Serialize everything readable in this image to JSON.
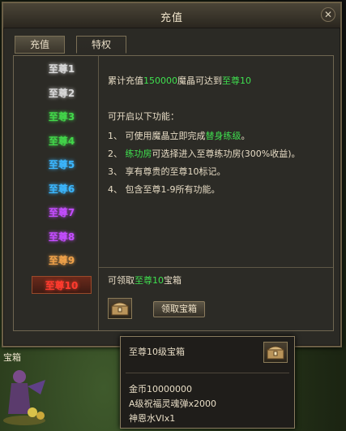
{
  "window": {
    "title": "充值",
    "close_glyph": "✕"
  },
  "tabs": [
    {
      "label": "充值",
      "active": false
    },
    {
      "label": "特权",
      "active": true
    }
  ],
  "vip_levels": [
    {
      "label": "至尊1",
      "color": "#d8d8d8"
    },
    {
      "label": "至尊2",
      "color": "#d8d8d8"
    },
    {
      "label": "至尊3",
      "color": "#42d64a"
    },
    {
      "label": "至尊4",
      "color": "#42d64a"
    },
    {
      "label": "至尊5",
      "color": "#3bb7ff"
    },
    {
      "label": "至尊6",
      "color": "#3bb7ff"
    },
    {
      "label": "至尊7",
      "color": "#c44dff"
    },
    {
      "label": "至尊8",
      "color": "#c44dff"
    },
    {
      "label": "至尊9",
      "color": "#f0a24a"
    },
    {
      "label": "至尊10",
      "color": "#ff3b2e"
    }
  ],
  "selected_vip_index": 9,
  "content": {
    "line1": {
      "prefix": "累计充值",
      "amount": "150000",
      "middle": "魔晶可达到",
      "level": "至尊10"
    },
    "features_header": "可开启以下功能：",
    "feature1": {
      "prefix": "1、 可使用魔晶立即完成",
      "highlight": "替身练级",
      "suffix": "。"
    },
    "feature2": {
      "prefix": "2、 ",
      "highlight": "练功房",
      "suffix": "可选择进入至尊练功房(300%收益)。"
    },
    "feature3": "3、 享有尊贵的至尊10标记。",
    "feature4": "4、 包含至尊1-9所有功能。"
  },
  "reward": {
    "prefix": "可领取",
    "highlight": "至尊10",
    "suffix": "宝箱",
    "button_label": "领取宝箱"
  },
  "tooltip": {
    "title": "至尊10级宝箱",
    "items": [
      "金币10000000",
      "A级祝福灵魂弹x2000",
      "神恩水VIx1"
    ]
  },
  "bottom_label": "宝箱",
  "colors": {
    "accent_green": "#3fe04f"
  },
  "icons": {
    "chest": "treasure-chest-icon",
    "close": "close-icon"
  }
}
